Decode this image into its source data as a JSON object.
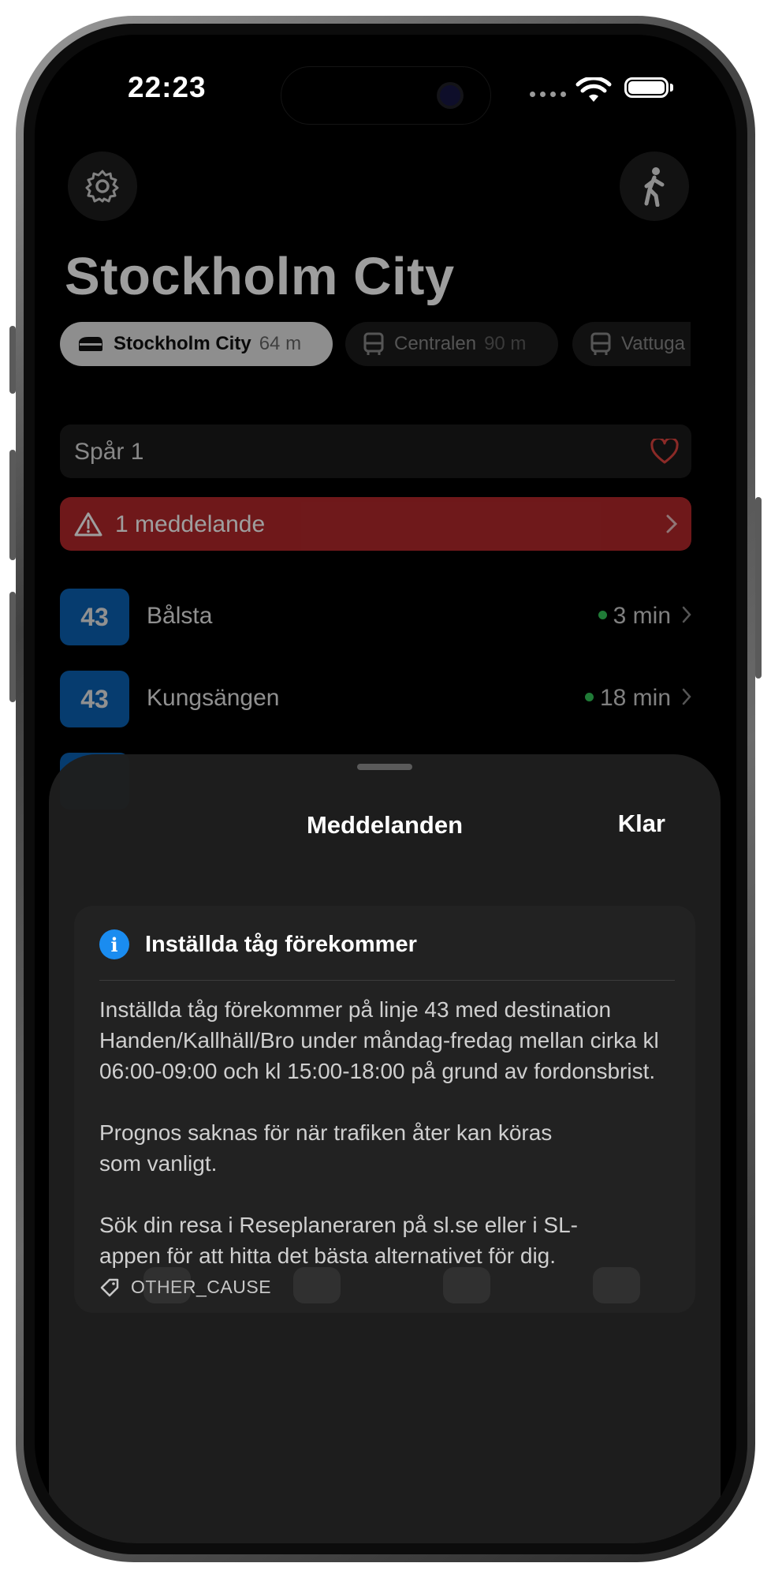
{
  "status_bar": {
    "time": "22:23"
  },
  "header": {
    "settings_icon": "gear-icon",
    "walk_icon": "figure-walk-icon",
    "title": "Stockholm City"
  },
  "stop_chips": [
    {
      "name": "Stockholm City",
      "distance": "64 m",
      "icon": "train-icon",
      "active": true
    },
    {
      "name": "Centralen",
      "distance": "90 m",
      "icon": "bus-icon",
      "active": false
    },
    {
      "name": "Vattuga",
      "distance": "",
      "icon": "bus-icon",
      "active": false
    }
  ],
  "platform": {
    "label": "Spår 1",
    "favorite_icon": "heart-icon"
  },
  "alert_banner": {
    "label": "1 meddelande",
    "icon": "warning-icon",
    "color": "#b3282b"
  },
  "departures": [
    {
      "line": "43",
      "destination": "Bålsta",
      "time": "3 min"
    },
    {
      "line": "43",
      "destination": "Kungsängen",
      "time": "18 min"
    }
  ],
  "sheet": {
    "title": "Meddelanden",
    "done_label": "Klar",
    "message": {
      "icon": "info-icon",
      "title": "Inställda tåg förekommer",
      "body_paragraphs": [
        "Inställda tåg förekommer på linje 43 med destination Handen/Kallhäll/Bro under måndag-fredag mellan cirka kl 06:00-09:00 och kl 15:00-18:00 på grund av fordonsbrist.",
        "Prognos saknas för när trafiken åter kan köras som vanligt.",
        "Sök din resa i Reseplaneraren på sl.se eller i SL-appen för att hitta det bästa alternativet för dig."
      ],
      "tag_icon": "tag-icon",
      "tag": "OTHER_CAUSE"
    }
  },
  "colors": {
    "line_badge": "#0a62b4",
    "alert": "#b3282b",
    "info": "#1a8cf0",
    "realtime_dot": "#34c759"
  }
}
